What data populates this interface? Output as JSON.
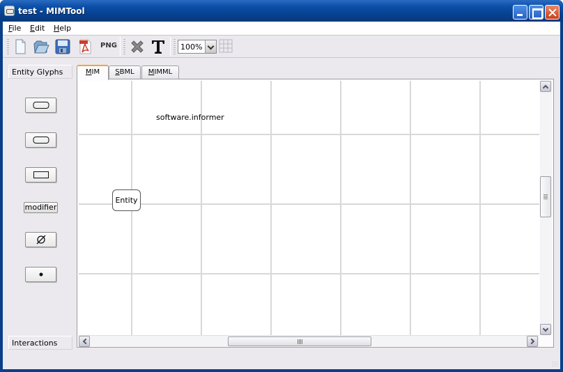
{
  "window": {
    "title": "test - MIMTool",
    "controls": [
      "minimize",
      "maximize",
      "close"
    ]
  },
  "menubar": {
    "items": [
      {
        "label": "File",
        "mnemonic": "F",
        "rest": "ile"
      },
      {
        "label": "Edit",
        "mnemonic": "E",
        "rest": "dit"
      },
      {
        "label": "Help",
        "mnemonic": "H",
        "rest": "elp"
      }
    ]
  },
  "toolbar": {
    "buttons": [
      {
        "name": "new",
        "icon": "new-file-icon"
      },
      {
        "name": "open",
        "icon": "open-folder-icon"
      },
      {
        "name": "save",
        "icon": "save-floppy-icon"
      },
      {
        "name": "export-pdf",
        "icon": "pdf-icon"
      },
      {
        "name": "export-png",
        "label": "PNG"
      },
      {
        "name": "delete",
        "icon": "delete-x-icon"
      },
      {
        "name": "text",
        "icon": "text-T-icon"
      },
      {
        "name": "grid",
        "icon": "grid-icon"
      }
    ],
    "png_label": "PNG",
    "zoom": {
      "value": "100%"
    }
  },
  "left_panel": {
    "entity_glyphs_label": "Entity Glyphs",
    "glyphs": [
      {
        "name": "rounded-entity"
      },
      {
        "name": "rounded-entity-2"
      },
      {
        "name": "rectangle-entity"
      },
      {
        "name": "modifier",
        "label": "modifier"
      },
      {
        "name": "empty-set",
        "label": "∅"
      },
      {
        "name": "point",
        "label": "•"
      }
    ],
    "interactions_label": "Interactions"
  },
  "tabs": [
    {
      "label": "MIM",
      "mnemonic": "M",
      "rest": "IM",
      "active": true
    },
    {
      "label": "SBML",
      "mnemonic": "S",
      "rest": "BML",
      "active": false
    },
    {
      "label": "MIMML",
      "mnemonic": "M",
      "rest": "IMML",
      "active": false
    }
  ],
  "canvas": {
    "text_label": "software.informer",
    "entity_label": "Entity"
  }
}
